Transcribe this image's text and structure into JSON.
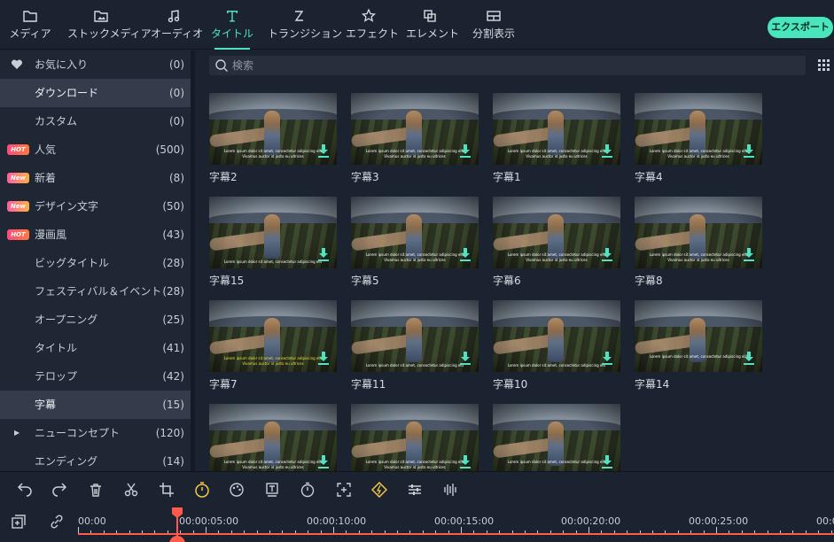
{
  "topbar": {
    "tabs": [
      {
        "label": "メディア",
        "icon": "folder-icon"
      },
      {
        "label": "ストックメディア",
        "icon": "image-folder-icon"
      },
      {
        "label": "オーディオ",
        "icon": "music-note-icon"
      },
      {
        "label": "タイトル",
        "icon": "title-t-icon",
        "active": true
      },
      {
        "label": "トランジション",
        "icon": "transition-icon"
      },
      {
        "label": "エフェクト",
        "icon": "effects-star-icon"
      },
      {
        "label": "エレメント",
        "icon": "elements-icon"
      },
      {
        "label": "分割表示",
        "icon": "split-screen-icon"
      }
    ],
    "export_label": "エクスポート",
    "accent_color": "#4fe3c1"
  },
  "sidebar": {
    "items": [
      {
        "label": "お気に入り",
        "count": "(0)",
        "icon": "heart-icon"
      },
      {
        "label": "ダウンロード",
        "count": "(0)",
        "selected": true
      },
      {
        "label": "カスタム",
        "count": "(0)"
      },
      {
        "label": "人気",
        "count": "(500)",
        "badge": "HOT"
      },
      {
        "label": "新着",
        "count": "(8)",
        "badge": "New"
      },
      {
        "label": "デザイン文字",
        "count": "(50)",
        "badge": "New"
      },
      {
        "label": "漫画風",
        "count": "(43)",
        "badge": "HOT"
      },
      {
        "label": "ビッグタイトル",
        "count": "(28)"
      },
      {
        "label": "フェスティバル＆イベント",
        "count": "(28)"
      },
      {
        "label": "オープニング",
        "count": "(25)"
      },
      {
        "label": "タイトル",
        "count": "(41)"
      },
      {
        "label": "テロップ",
        "count": "(42)"
      },
      {
        "label": "字幕",
        "count": "(15)",
        "selected": true
      },
      {
        "label": "ニューコンセプト",
        "count": "(120)",
        "expandable": true
      },
      {
        "label": "エンディング",
        "count": "(14)"
      }
    ]
  },
  "search": {
    "placeholder": "検索"
  },
  "grid": {
    "caption_text": "Lorem ipsum dolor sit amet, consectetur adipiscing elit",
    "caption_text2": "Vivamus auctor id justo eu ultrices",
    "items": [
      {
        "name": "字幕2"
      },
      {
        "name": "字幕3"
      },
      {
        "name": "字幕1"
      },
      {
        "name": "字幕4"
      },
      {
        "name": "字幕15"
      },
      {
        "name": "字幕5"
      },
      {
        "name": "字幕6"
      },
      {
        "name": "字幕8"
      },
      {
        "name": "字幕7"
      },
      {
        "name": "字幕11"
      },
      {
        "name": "字幕10"
      },
      {
        "name": "字幕14"
      },
      {
        "name": ""
      },
      {
        "name": ""
      },
      {
        "name": ""
      }
    ]
  },
  "toolbar": {
    "tools": [
      "undo-icon",
      "redo-icon",
      "delete-icon",
      "cut-icon",
      "crop-icon",
      "speed-icon",
      "color-icon",
      "text-icon",
      "timer-icon",
      "fit-icon",
      "ai-icon",
      "adjust-icon",
      "audio-icon"
    ]
  },
  "timeline": {
    "ticks": [
      "00:00",
      "00:00:05:00",
      "00:00:10:00",
      "00:00:15:00",
      "00:00:20:00",
      "00:00:25:00",
      "00:00:"
    ],
    "playhead_color": "#ff5a4a"
  }
}
